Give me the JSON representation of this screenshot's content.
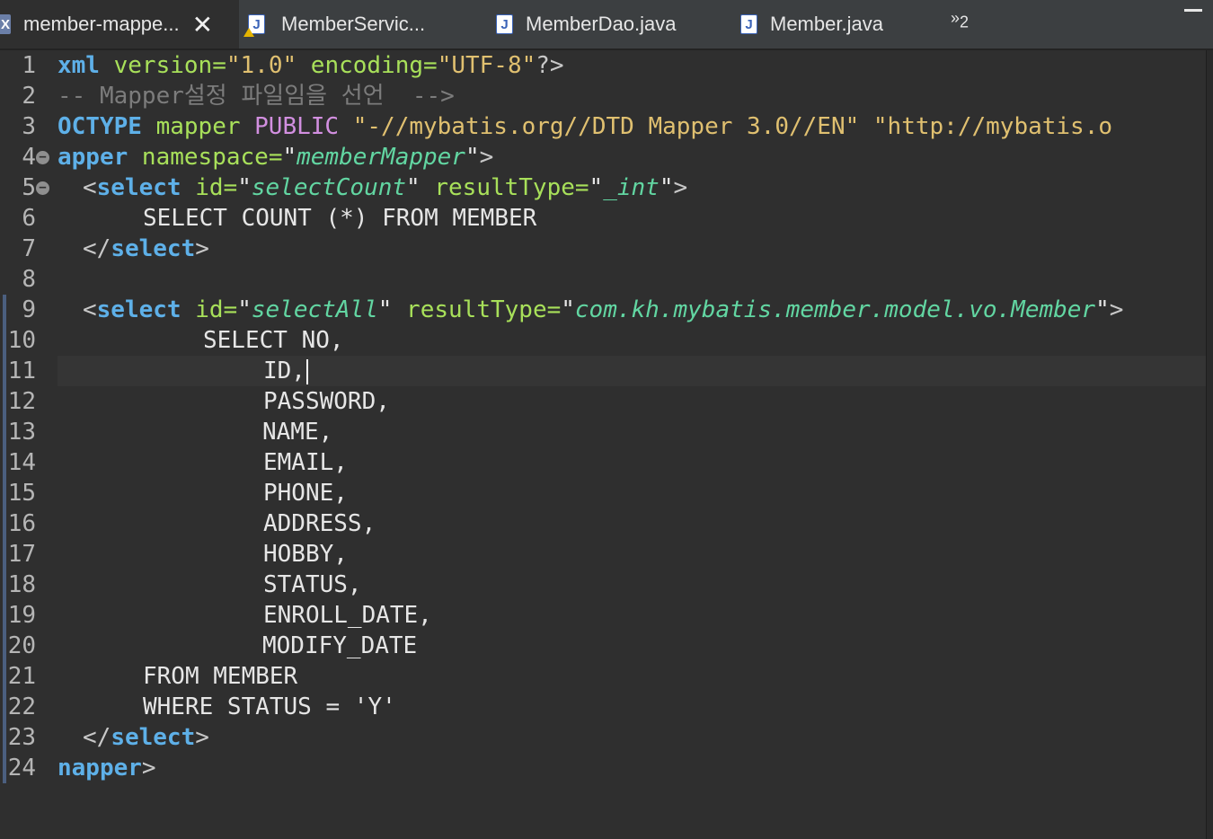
{
  "tabs": [
    {
      "label": "member-mappe...",
      "icon": "xml-file-icon",
      "active": true,
      "close": "✕"
    },
    {
      "label": "MemberServic...",
      "icon": "java-file-icon",
      "warning": true
    },
    {
      "label": "MemberDao.java",
      "icon": "java-file-icon"
    },
    {
      "label": "Member.java",
      "icon": "java-file-icon"
    }
  ],
  "tab_overflow": {
    "symbol": "»",
    "count": "2"
  },
  "editor": {
    "line_numbers": [
      "1",
      "2",
      "3",
      "4",
      "5",
      "6",
      "7",
      "8",
      "9",
      "10",
      "11",
      "12",
      "13",
      "14",
      "15",
      "16",
      "17",
      "18",
      "19",
      "20",
      "21",
      "22",
      "23",
      "24"
    ],
    "lines": {
      "l1": {
        "a": "xml",
        "b": " version=",
        "c": "\"1.0\"",
        "d": " encoding=",
        "e": "\"UTF-8\"",
        "f": "?>"
      },
      "l2": {
        "a": "-- Mapper설정 파일임을 선언  -->"
      },
      "l3": {
        "a": "OCTYPE",
        "b": " mapper ",
        "c": "PUBLIC",
        "d": " \"-//mybatis.org//DTD Mapper 3.0//EN\" \"http://mybatis.o"
      },
      "l4": {
        "a": "apper",
        "b": " namespace=",
        "c": "\"",
        "d": "memberMapper",
        "e": "\"",
        "f": ">"
      },
      "l5": {
        "a": "<",
        "b": "select",
        "c": " id=",
        "d": "\"",
        "e": "selectCount",
        "f": "\"",
        "g": " resultType=",
        "h": "\"",
        "i": "_int",
        "j": "\"",
        "k": ">"
      },
      "l6": {
        "a": "SELECT COUNT (*) FROM MEMBER"
      },
      "l7": {
        "a": "</",
        "b": "select",
        "c": ">"
      },
      "l9": {
        "a": "<",
        "b": "select",
        "c": " id=",
        "d": "\"",
        "e": "selectAll",
        "f": "\"",
        "g": " resultType=",
        "h": "\"",
        "i": "com.kh.mybatis.member.model.vo.Member",
        "j": "\"",
        "k": ">"
      },
      "l10": {
        "a": "SELECT NO,"
      },
      "l11": {
        "a": "ID,"
      },
      "l12": {
        "a": "PASSWORD,"
      },
      "l13": {
        "a": "NAME,"
      },
      "l14": {
        "a": "EMAIL,"
      },
      "l15": {
        "a": "PHONE,"
      },
      "l16": {
        "a": "ADDRESS,"
      },
      "l17": {
        "a": "HOBBY,"
      },
      "l18": {
        "a": "STATUS,"
      },
      "l19": {
        "a": "ENROLL_DATE,"
      },
      "l20": {
        "a": "MODIFY_DATE"
      },
      "l21": {
        "a": "FROM MEMBER"
      },
      "l22": {
        "a": "WHERE STATUS = 'Y'"
      },
      "l23": {
        "a": "</",
        "b": "select",
        "c": ">"
      },
      "l24": {
        "a": "napper",
        "b": ">"
      }
    }
  }
}
